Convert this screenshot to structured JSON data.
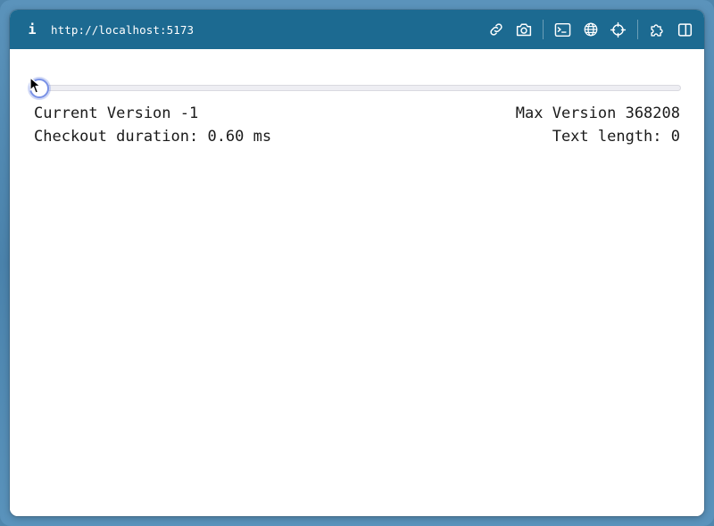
{
  "browser": {
    "info_label": "i",
    "url": "http://localhost:5173",
    "tools": [
      "link-icon",
      "camera-icon",
      "terminal-icon",
      "globe-icon",
      "crosshair-icon",
      "puzzle-icon",
      "sidebar-icon"
    ]
  },
  "slider": {
    "value_fraction": 0.0
  },
  "stats": {
    "current_version": "Current Version -1",
    "max_version": "Max Version 368208",
    "checkout_duration": "Checkout duration: 0.60 ms",
    "text_length": "Text length: 0"
  },
  "colors": {
    "toolbar": "#1c6a91",
    "frame": "#4f86ad",
    "thumb_border": "#7a92e6"
  }
}
